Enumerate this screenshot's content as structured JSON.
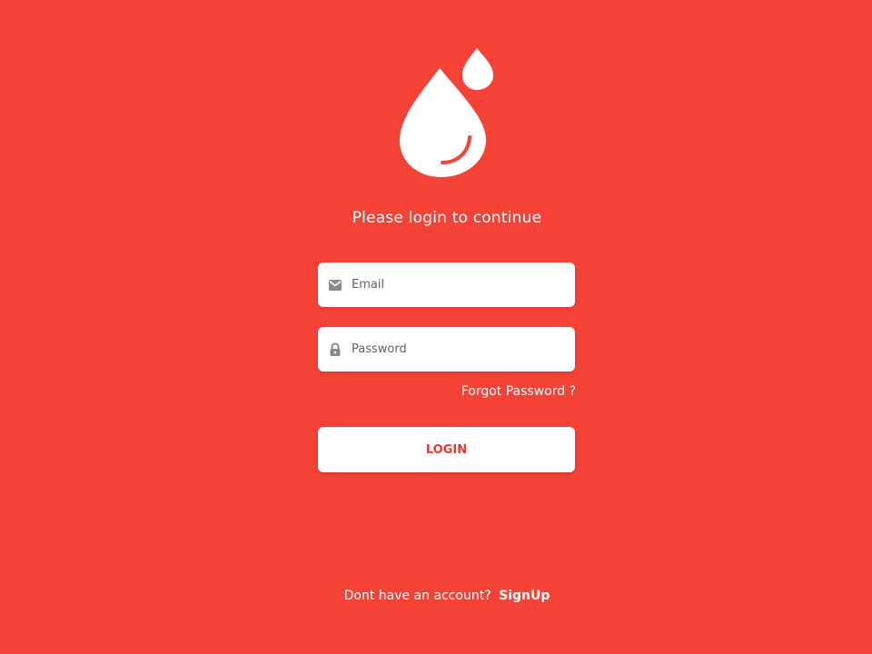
{
  "colors": {
    "background": "#F44336",
    "surface": "#FFFFFF",
    "accent_text": "#E53935",
    "placeholder": "#616161",
    "icon": "#8A8A8A"
  },
  "logo": {
    "icon": "blood-drop-icon"
  },
  "header": {
    "subtitle": "Please login to continue"
  },
  "form": {
    "email": {
      "icon": "envelope-icon",
      "placeholder": "Email",
      "value": ""
    },
    "password": {
      "icon": "lock-icon",
      "placeholder": "Password",
      "value": ""
    },
    "forgot_password": "Forgot Password ?",
    "login_label": "LOGIN"
  },
  "footer": {
    "prompt": "Dont have an account?",
    "signup_label": "SignUp"
  }
}
